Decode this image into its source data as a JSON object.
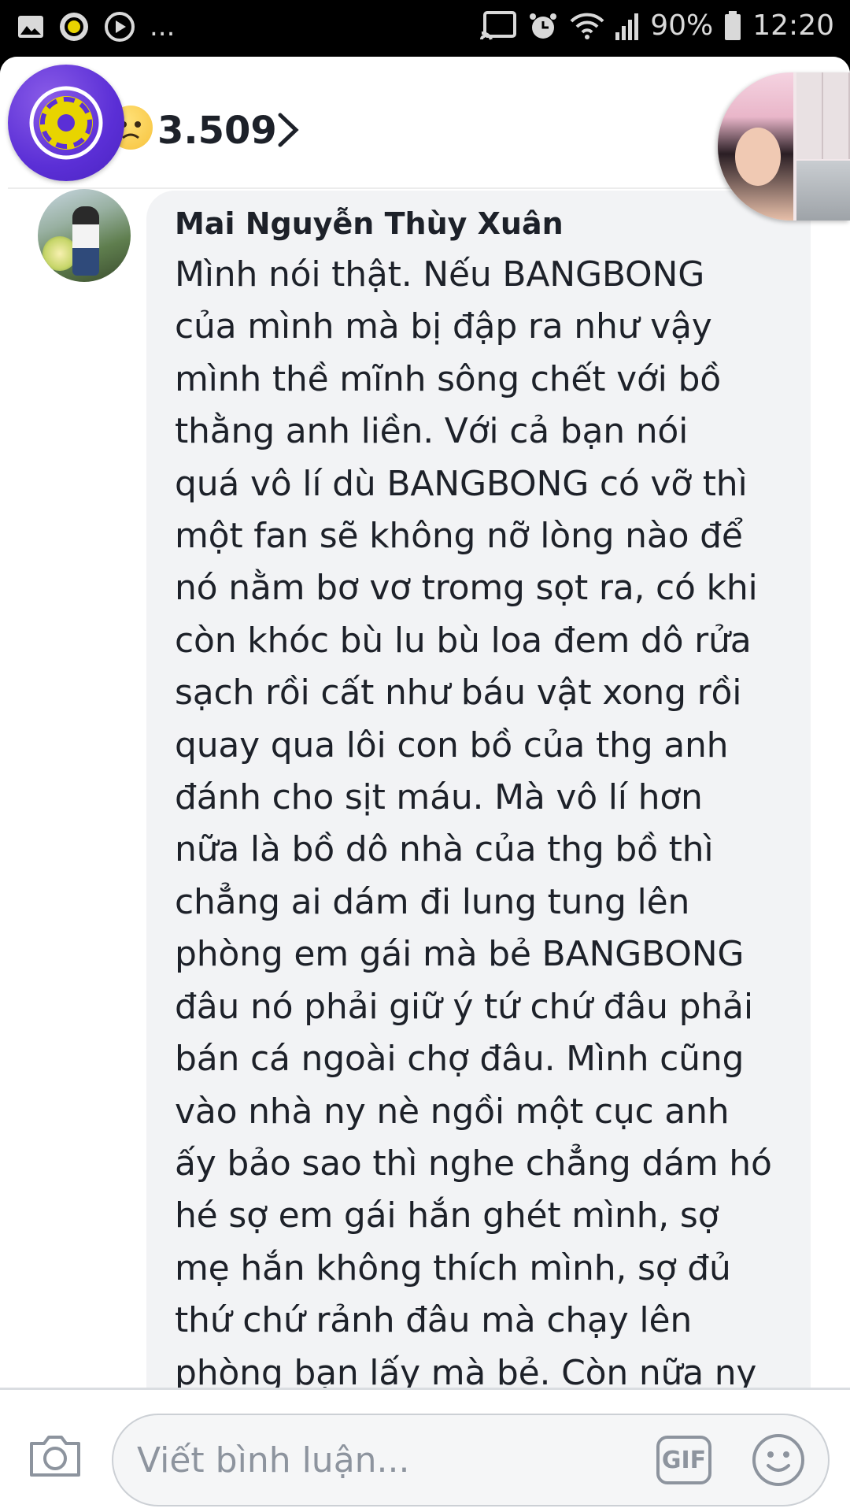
{
  "status_bar": {
    "left_more": "...",
    "battery": "90%",
    "time": "12:20"
  },
  "header": {
    "reaction_count": "3.509"
  },
  "comment": {
    "author": "Mai Nguyễn Thùy Xuân",
    "text": "Mình nói thật. Nếu BANGBONG\ncủa mình mà bị đập ra như vậy\nmình thề mĩnh sông chết với bồ\nthằng anh liền. Với cả bạn nói\nquá vô lí dù BANGBONG có vỡ thì\nmột fan sẽ không nỡ lòng nào để\nnó nằm bơ vơ tromg sọt ra, có khi\ncòn khóc bù lu bù loa đem dô rửa\nsạch rồi cất như báu vật xong rồi\nquay qua lôi con bồ của thg anh\nđánh cho sịt máu. Mà vô lí hơn\nnữa là bồ dô nhà của thg bồ thì\nchẳng ai dám đi lung tung lên\nphòng em gái mà bẻ BANGBONG\nđâu nó phải giữ ý tứ chứ đâu phải\nbán cá ngoài chợ đâu. Mình cũng\nvào nhà ny nè ngồi một cục anh\nấy bảo sao thì nghe chẳng dám hó\nhé sợ em gái hắn ghét mình, sợ\nmẹ hắn không thích mình, sợ đủ\nthứ chứ rảnh đâu mà chạy lên\nphòng bạn lấy mà bẻ. Còn nữa ny"
  },
  "composer": {
    "placeholder": "Viết bình luận...",
    "gif_label": "GIF"
  },
  "icons": {
    "status_left": [
      "gallery-icon",
      "camera-app-icon",
      "media-icon"
    ],
    "status_right": [
      "cast-icon",
      "alarm-icon",
      "wifi-icon",
      "signal-icon",
      "battery-icon"
    ],
    "header": [
      "app-logo-icon",
      "sad-reaction-icon",
      "chevron-right-icon"
    ],
    "composer": [
      "camera-icon",
      "gif-icon",
      "emoji-icon"
    ]
  },
  "colors": {
    "bubble": "#f2f3f5",
    "text": "#1d2129",
    "placeholder": "#8d949e",
    "logo": "#5b2fd6"
  }
}
